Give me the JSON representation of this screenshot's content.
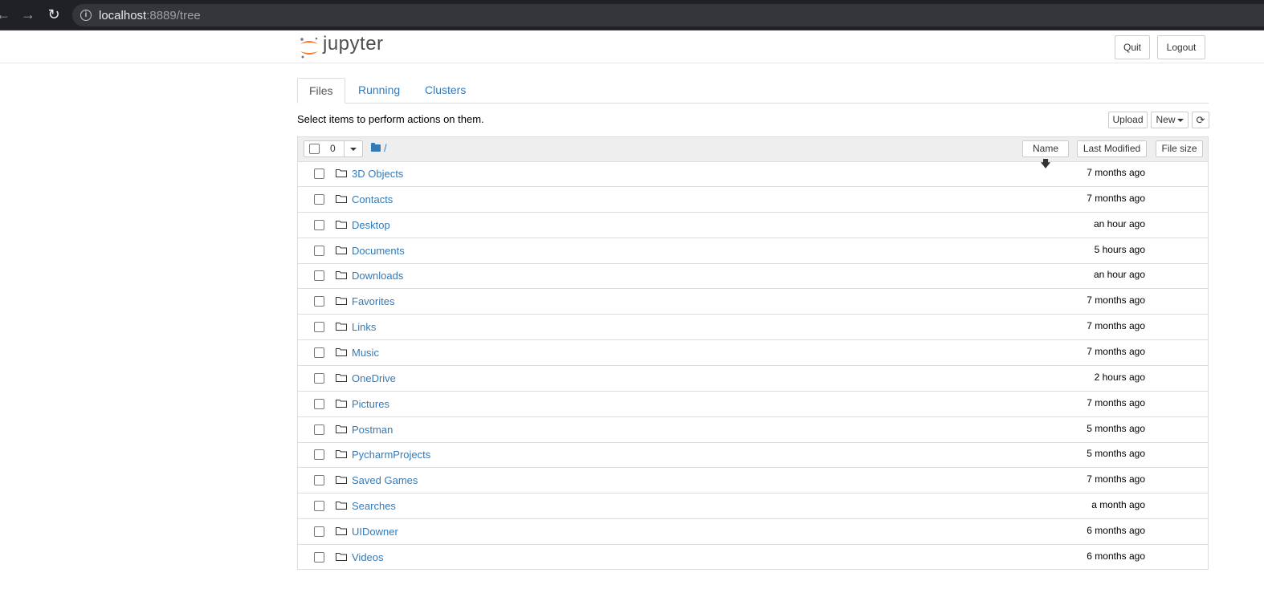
{
  "browser": {
    "url_host": "localhost",
    "url_rest": ":8889/tree"
  },
  "header": {
    "logo_text": "jupyter",
    "quit_label": "Quit",
    "logout_label": "Logout"
  },
  "tabs": [
    {
      "label": "Files",
      "active": true
    },
    {
      "label": "Running",
      "active": false
    },
    {
      "label": "Clusters",
      "active": false
    }
  ],
  "toolbar": {
    "hint": "Select items to perform actions on them.",
    "upload_label": "Upload",
    "new_label": "New",
    "refresh_icon": "refresh-icon"
  },
  "list_header": {
    "selected_count": "0",
    "breadcrumb": "/",
    "sort_name_label": "Name",
    "sort_modified_label": "Last Modified",
    "sort_size_label": "File size"
  },
  "files": [
    {
      "name": "3D Objects",
      "modified": "7 months ago"
    },
    {
      "name": "Contacts",
      "modified": "7 months ago"
    },
    {
      "name": "Desktop",
      "modified": "an hour ago"
    },
    {
      "name": "Documents",
      "modified": "5 hours ago"
    },
    {
      "name": "Downloads",
      "modified": "an hour ago"
    },
    {
      "name": "Favorites",
      "modified": "7 months ago"
    },
    {
      "name": "Links",
      "modified": "7 months ago"
    },
    {
      "name": "Music",
      "modified": "7 months ago"
    },
    {
      "name": "OneDrive",
      "modified": "2 hours ago"
    },
    {
      "name": "Pictures",
      "modified": "7 months ago"
    },
    {
      "name": "Postman",
      "modified": "5 months ago"
    },
    {
      "name": "PycharmProjects",
      "modified": "5 months ago"
    },
    {
      "name": "Saved Games",
      "modified": "7 months ago"
    },
    {
      "name": "Searches",
      "modified": "a month ago"
    },
    {
      "name": "UIDowner",
      "modified": "6 months ago"
    },
    {
      "name": "Videos",
      "modified": "6 months ago"
    }
  ],
  "colors": {
    "link": "#337ab7",
    "chrome_bg": "#202124",
    "jupyter_orange": "#f37726"
  }
}
